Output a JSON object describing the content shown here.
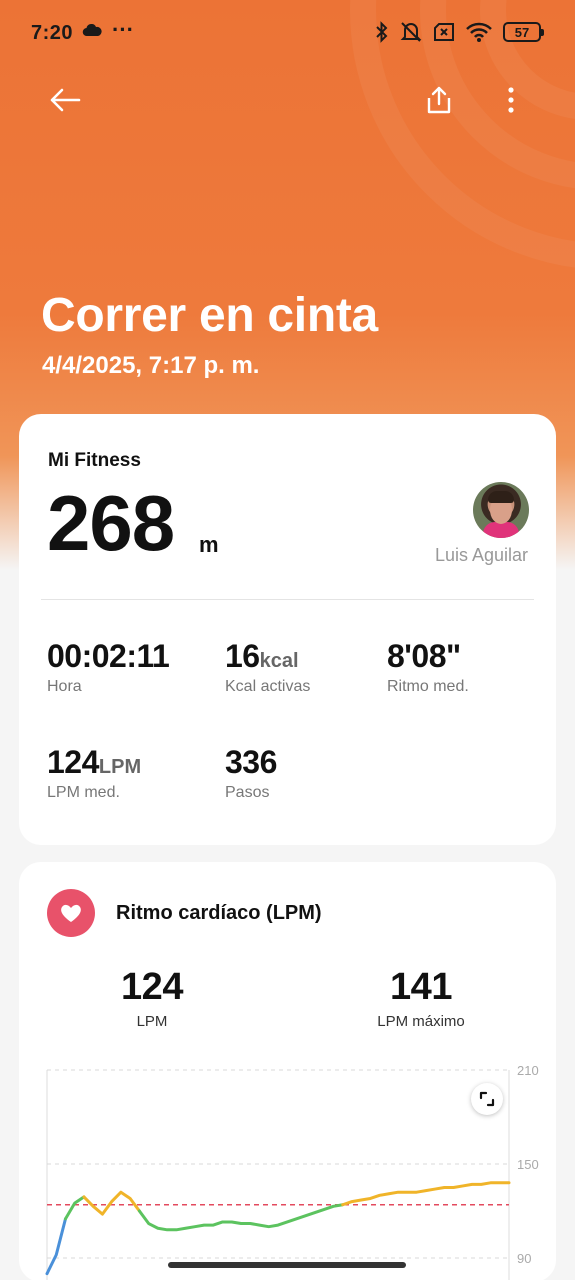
{
  "status_bar": {
    "time": "7:20",
    "more": "···",
    "battery": "57",
    "icons": [
      "cloud-icon",
      "bluetooth-icon",
      "mute-icon",
      "no-sim-icon",
      "wifi-icon",
      "battery-icon"
    ]
  },
  "header": {
    "title": "Correr en cinta",
    "subtitle": "4/4/2025, 7:17 p. m.",
    "back_icon": "arrow-left-icon",
    "share_icon": "share-icon",
    "more_icon": "more-vertical-icon",
    "accent_color": "#ec7336"
  },
  "summary": {
    "app_name": "Mi Fitness",
    "distance_value": "268",
    "distance_unit": "m",
    "user_name": "Luis Aguilar",
    "stats": [
      {
        "value": "00:02:11",
        "unit": "",
        "label": "Hora"
      },
      {
        "value": "16",
        "unit": "kcal",
        "label": "Kcal activas"
      },
      {
        "value": "8'08\"",
        "unit": "",
        "label": "Ritmo med."
      },
      {
        "value": "124",
        "unit": "LPM",
        "label": "LPM med."
      },
      {
        "value": "336",
        "unit": "",
        "label": "Pasos"
      }
    ]
  },
  "heart_rate": {
    "title": "Ritmo cardíaco (LPM)",
    "icon": "heart-icon",
    "icon_color": "#e8526a",
    "avg_value": "124",
    "avg_label": "LPM",
    "max_value": "141",
    "max_label": "LPM máximo",
    "expand_icon": "expand-icon"
  },
  "chart_data": {
    "type": "line",
    "y_ticks": [
      "210",
      "150",
      "90"
    ],
    "ylim": [
      90,
      210
    ],
    "reference_line": 124,
    "grid": true,
    "x": [
      0,
      1,
      2,
      3,
      4,
      5,
      6,
      7,
      8,
      9,
      10,
      11,
      12,
      13,
      14,
      15,
      16,
      17,
      18,
      19,
      20,
      21,
      22,
      23,
      24,
      25,
      26,
      27,
      28,
      29,
      30,
      31,
      32,
      33,
      34,
      35,
      36,
      37,
      38,
      39,
      40,
      41,
      42,
      43,
      44,
      45,
      46,
      47,
      48,
      49,
      50
    ],
    "values": [
      80,
      92,
      115,
      125,
      129,
      123,
      118,
      126,
      132,
      128,
      120,
      112,
      109,
      108,
      108,
      109,
      110,
      111,
      111,
      113,
      113,
      112,
      112,
      111,
      110,
      111,
      113,
      115,
      117,
      119,
      121,
      123,
      124,
      126,
      127,
      128,
      130,
      131,
      132,
      132,
      132,
      133,
      134,
      135,
      135,
      136,
      137,
      137,
      138,
      138,
      138
    ],
    "zones": [
      {
        "from": 0,
        "to": 2,
        "color": "#4a90d9"
      },
      {
        "from": 2,
        "to": 4,
        "color": "#5cc35f"
      },
      {
        "from": 4,
        "to": 10,
        "color": "#f0b429"
      },
      {
        "from": 10,
        "to": 32,
        "color": "#5cc35f"
      },
      {
        "from": 32,
        "to": 50,
        "color": "#f0b429"
      }
    ],
    "reference_color": "#e34a5e"
  }
}
